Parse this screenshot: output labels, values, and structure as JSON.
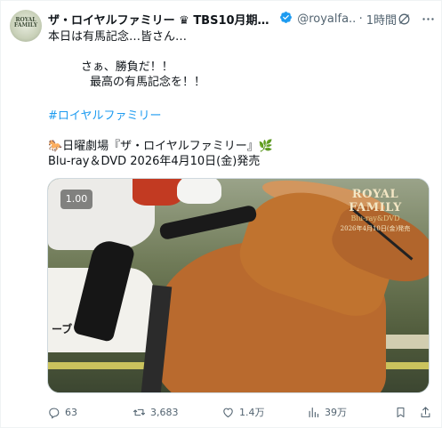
{
  "tweet": {
    "display_name": "ザ・ロイヤルファミリー ♛ TBS10月期日曜...",
    "handle": "@royalfa...",
    "separator": "·",
    "time": "1時間",
    "avatar_text": [
      "ROYAL",
      "FAMILY"
    ],
    "lines": [
      "本日は有馬記念…皆さん…",
      "さぁ、勝負だ！！",
      "最高の有馬記念を！！",
      "#ロイヤルファミリー",
      "🐎日曜劇場『ザ・ロイヤルファミリー』🌿",
      "Blu-ray＆DVD 2026年4月10日(金)発売"
    ]
  },
  "media": {
    "playback_rate": "1.00",
    "cloth_text": "ーブ",
    "brand_title": "ROYAL FAMILY",
    "brand_sub": "Blu-ray&DVD",
    "brand_date": "2026年4月10日(金)発売"
  },
  "actions": {
    "replies": "63",
    "reposts": "3,683",
    "likes": "1.4万",
    "views": "39万"
  },
  "icons": [
    "verified-badge-icon",
    "grok-icon",
    "more-icon",
    "reply-icon",
    "repost-icon",
    "like-icon",
    "views-icon",
    "bookmark-icon",
    "share-icon"
  ],
  "colors": {
    "text": "#0f1419",
    "secondary": "#536471",
    "link": "#1d9bf0",
    "verified": "#1d9bf0"
  }
}
